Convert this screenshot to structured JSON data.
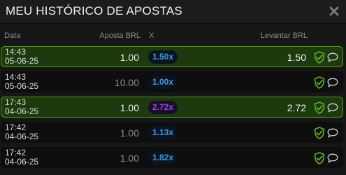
{
  "header": {
    "title": "MEU HISTÓRICO DE APOSTAS"
  },
  "columns": {
    "date": "Data",
    "bet": "Aposta BRL",
    "multiplier": "X",
    "cashout": "Levantar BRL"
  },
  "rows": [
    {
      "time": "14:43",
      "date": "05-06-25",
      "bet": "1.00",
      "multiplier": "1.50x",
      "cashout": "1.50",
      "status": "win",
      "mult_color": "blue"
    },
    {
      "time": "14:43",
      "date": "05-06-25",
      "bet": "10.00",
      "multiplier": "1.00x",
      "cashout": "",
      "status": "lost",
      "mult_color": "blue"
    },
    {
      "time": "17:43",
      "date": "04-06-25",
      "bet": "1.00",
      "multiplier": "2.72x",
      "cashout": "2.72",
      "status": "win",
      "mult_color": "purple"
    },
    {
      "time": "17:42",
      "date": "04-06-25",
      "bet": "1.00",
      "multiplier": "1.13x",
      "cashout": "",
      "status": "lost",
      "mult_color": "blue"
    },
    {
      "time": "17:42",
      "date": "04-06-25",
      "bet": "1.00",
      "multiplier": "1.82x",
      "cashout": "",
      "status": "lost",
      "mult_color": "blue"
    }
  ],
  "icons": {
    "close": "close-icon",
    "fairness": "shield-check-icon",
    "chat": "chat-bubble-icon"
  },
  "colors": {
    "win_background": "#1d3a0f",
    "win_border": "#4f9e14",
    "multiplier_blue": "#3f9bd6",
    "multiplier_purple": "#9f3ff0",
    "shield_green": "#5cb31f"
  }
}
